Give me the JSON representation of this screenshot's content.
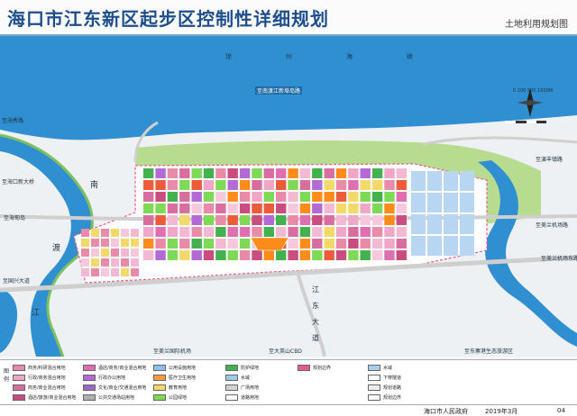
{
  "header": {
    "title": "海口市江东新区起步区控制性详细规划",
    "subtitle": "土地利用规划图"
  },
  "map": {
    "strait_label": "琼州海峡",
    "places": {
      "nandu_river_village": "至南渡江新埠岛路",
      "haixiu_road": "至海秀路",
      "xindaqiao_nw": "至海口新大桥",
      "yanfeng_town": "至演丰镇路",
      "meilan_airport_road": "至美兰机场路",
      "haidian_island": "至海甸岛",
      "guoxing": "至国兴大道",
      "meilan_airport_bottom": "至美兰国际机场",
      "dongzhaigang_ecology": "至东寨港生态旅游区",
      "cbd": "至大英山CBD",
      "meilan_east": "至美兰机场东路",
      "road_vertical": "江东大道"
    },
    "river_chars": [
      "南",
      "渡",
      "江"
    ],
    "scale_label": "0 200 500 1000M"
  },
  "legend": {
    "tag": "图例",
    "items": [
      {
        "code": "B1/B2",
        "label": "商务/科研混合用地",
        "color": "#e98aa8"
      },
      {
        "code": "B1/R2",
        "label": "行政/商务混合用地",
        "color": "#f0a6c6"
      },
      {
        "code": "B1",
        "label": "商务/商业混合用地",
        "color": "#d86ea0"
      },
      {
        "code": "B2",
        "label": "酒店/旅游/商业混合用地",
        "color": "#c94d7e"
      },
      {
        "code": "R2",
        "label": "酒店/商务/商业混合用地",
        "color": "#e06fb2"
      },
      {
        "code": "A1",
        "label": "行政办公用地",
        "color": "#b46ad4"
      },
      {
        "code": "A2",
        "label": "文化/商业/交通混合用地",
        "color": "#9966cc"
      },
      {
        "code": "S4",
        "label": "公共交通场站用地",
        "color": "#b0b0b0"
      },
      {
        "code": "U",
        "label": "公用设施用地",
        "color": "#8fc0e6"
      },
      {
        "code": "A5",
        "label": "医疗卫生用地",
        "color": "#ff9b3a"
      },
      {
        "code": "A3",
        "label": "教育用地",
        "color": "#f2d96a"
      },
      {
        "code": "G1",
        "label": "公园绿地",
        "color": "#7ed957"
      },
      {
        "code": "G2",
        "label": "防护绿地",
        "color": "#42b14e"
      },
      {
        "code": "E1",
        "label": "水域",
        "color": "#9dc9ee"
      },
      {
        "code": "G3",
        "label": "广场用地",
        "color": "#d2d2d2"
      },
      {
        "code": "S1",
        "label": "道路用地",
        "color": "#ffffff"
      },
      {
        "code": "BJ",
        "label": "规划边界",
        "color": "#e85a8a"
      }
    ],
    "right_items": [
      {
        "label": "水域",
        "color": "#a6cfee"
      },
      {
        "label": "下穿隧道",
        "color": "#ffffff"
      },
      {
        "label": "规划道路",
        "color": "#eeeeee"
      },
      {
        "label": "规划边界",
        "color": "#ffffff"
      }
    ]
  },
  "footer": {
    "org": "海口市人民政府",
    "date": "2019年3月",
    "page": "04"
  }
}
